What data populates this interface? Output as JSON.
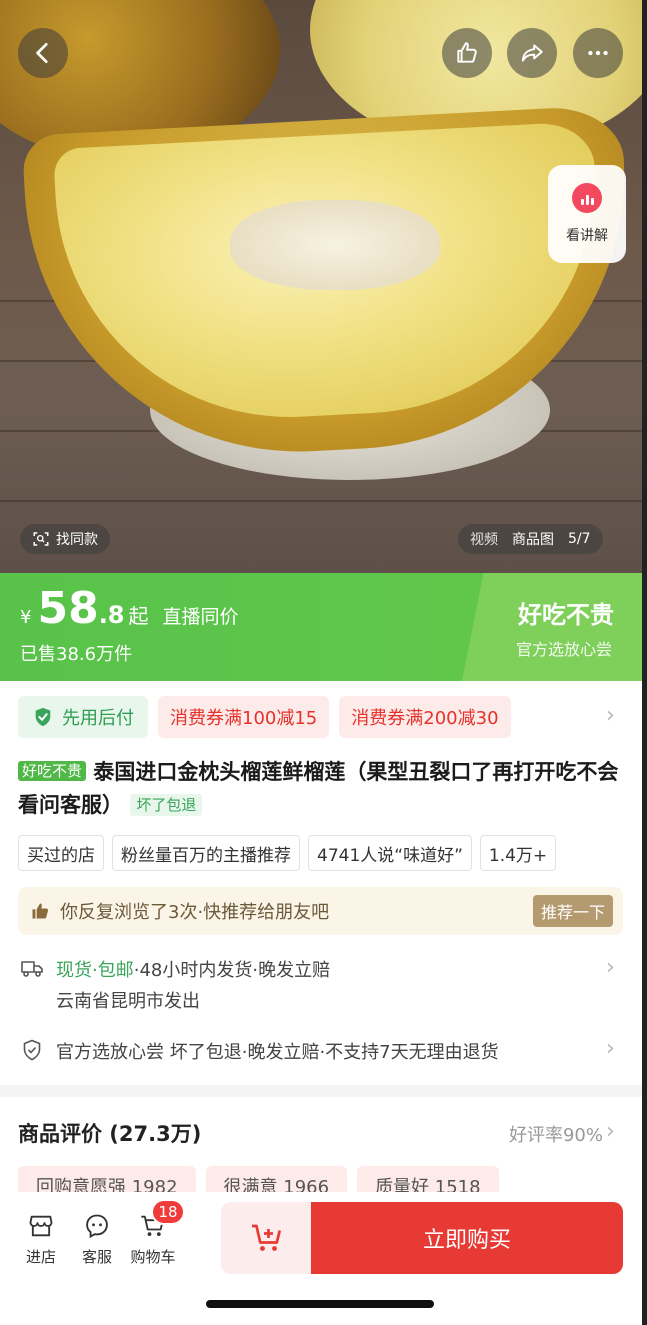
{
  "gallery": {
    "find_similar": "找同款",
    "tabs": [
      "视频",
      "商品图"
    ],
    "counter": "5/7",
    "live_card_label": "看讲解"
  },
  "price": {
    "currency": "¥",
    "integer": "58",
    "decimal": ".8",
    "suffix": "起",
    "note": "直播同价",
    "sold": "已售38.6万件",
    "slogan": "好吃不贵",
    "slogan_sub": "官方选放心尝"
  },
  "coupons": {
    "pay_later": "先用后付",
    "items": [
      "消费券满100减15",
      "消费券满200减30"
    ]
  },
  "product": {
    "tag": "好吃不贵",
    "title": "泰国进口金枕头榴莲鲜榴莲（果型丑裂口了再打开吃不会看问客服）",
    "tag_after": "坏了包退"
  },
  "highlights": [
    "买过的店",
    "粉丝量百万的主播推荐",
    "4741人说“味道好”",
    "1.4万+"
  ],
  "recommend": {
    "text": "你反复浏览了3次·快推荐给朋友吧",
    "button": "推荐一下"
  },
  "shipping": {
    "status": "现货·包邮",
    "detail": "·48小时内发货·晚发立赔",
    "origin": "云南省昆明市发出"
  },
  "guarantee": "官方选放心尝 坏了包退·晚发立赔·不支持7天无理由退货",
  "reviews": {
    "title": "商品评价 (27.3万)",
    "rate": "好评率90%",
    "tags": [
      "回购意愿强 1982",
      "很满意 1966",
      "质量好 1518"
    ]
  },
  "bottom_bar": {
    "store": "进店",
    "service": "客服",
    "cart": "购物车",
    "cart_count": "18",
    "buy_now": "立即购买"
  },
  "colors": {
    "accent_green": "#58c24a",
    "buy_red": "#e83a35",
    "coupon_red": "#e5322c"
  }
}
